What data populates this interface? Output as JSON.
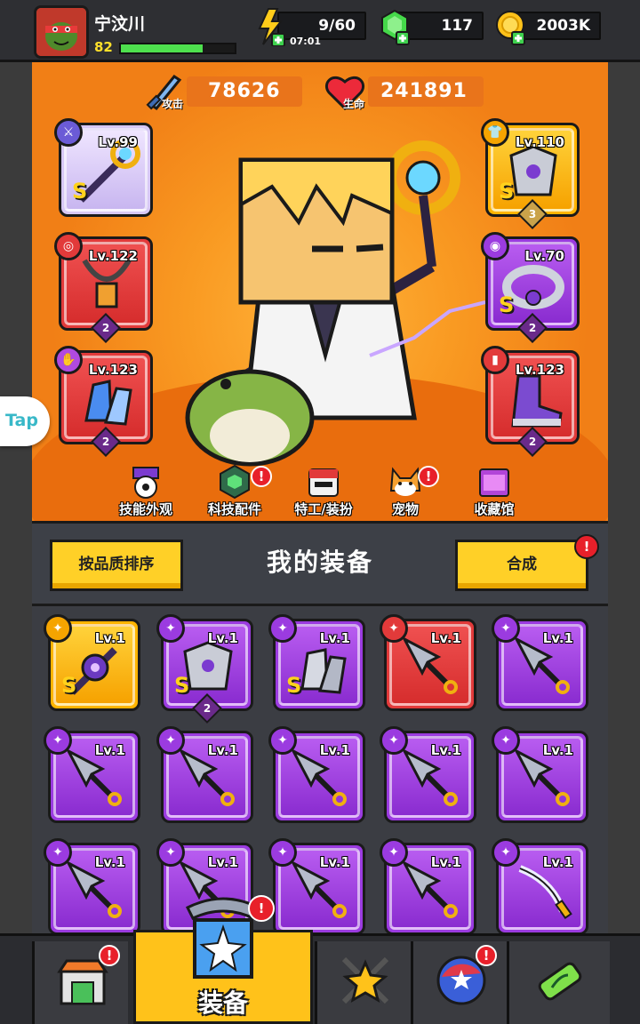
{
  "player": {
    "name": "宁汶川",
    "level": "82",
    "xp_fraction": 0.72
  },
  "resources": {
    "energy": {
      "value": "9/60",
      "timer": "07:01"
    },
    "gems": {
      "value": "117"
    },
    "coins": {
      "value": "2003K"
    }
  },
  "stats": {
    "attack": {
      "label": "攻击",
      "value": "78626"
    },
    "hp": {
      "label": "生命",
      "value": "241891"
    }
  },
  "equipped": {
    "weapon": {
      "level": "Lv.99",
      "grade": "S",
      "badge": ""
    },
    "armor": {
      "level": "Lv.110",
      "grade": "S",
      "badge": "3"
    },
    "necklace": {
      "level": "Lv.122",
      "grade": "",
      "badge": "2"
    },
    "belt": {
      "level": "Lv.70",
      "grade": "S",
      "badge": "2"
    },
    "gloves": {
      "level": "Lv.123",
      "grade": "",
      "badge": "2"
    },
    "boots": {
      "level": "Lv.123",
      "grade": "",
      "badge": "2"
    }
  },
  "nav": [
    {
      "label": "技能外观",
      "alert": false
    },
    {
      "label": "科技配件",
      "alert": true
    },
    {
      "label": "特工/装扮",
      "alert": false
    },
    {
      "label": "宠物",
      "alert": true
    },
    {
      "label": "收藏馆",
      "alert": false
    }
  ],
  "inventory": {
    "title": "我的装备",
    "sort_button": "按品质排序",
    "merge_button": "合成",
    "items": [
      {
        "level": "Lv.1",
        "rarity": "gold",
        "type": "staff",
        "grade": "S",
        "badge": ""
      },
      {
        "level": "Lv.1",
        "rarity": "purple",
        "type": "armor",
        "grade": "S",
        "badge": "2"
      },
      {
        "level": "Lv.1",
        "rarity": "purple",
        "type": "gloves",
        "grade": "S",
        "badge": ""
      },
      {
        "level": "Lv.1",
        "rarity": "red",
        "type": "kunai",
        "grade": "",
        "badge": ""
      },
      {
        "level": "Lv.1",
        "rarity": "purple",
        "type": "kunai",
        "grade": "",
        "badge": ""
      },
      {
        "level": "Lv.1",
        "rarity": "purple",
        "type": "kunai",
        "grade": "",
        "badge": ""
      },
      {
        "level": "Lv.1",
        "rarity": "purple",
        "type": "kunai",
        "grade": "",
        "badge": ""
      },
      {
        "level": "Lv.1",
        "rarity": "purple",
        "type": "kunai",
        "grade": "",
        "badge": ""
      },
      {
        "level": "Lv.1",
        "rarity": "purple",
        "type": "kunai",
        "grade": "",
        "badge": ""
      },
      {
        "level": "Lv.1",
        "rarity": "purple",
        "type": "kunai",
        "grade": "",
        "badge": ""
      },
      {
        "level": "Lv.1",
        "rarity": "purple",
        "type": "kunai",
        "grade": "",
        "badge": ""
      },
      {
        "level": "Lv.1",
        "rarity": "purple",
        "type": "kunai",
        "grade": "",
        "badge": ""
      },
      {
        "level": "Lv.1",
        "rarity": "purple",
        "type": "kunai",
        "grade": "",
        "badge": ""
      },
      {
        "level": "Lv.1",
        "rarity": "purple",
        "type": "kunai",
        "grade": "",
        "badge": ""
      },
      {
        "level": "Lv.1",
        "rarity": "purple",
        "type": "katana",
        "grade": "",
        "badge": ""
      }
    ]
  },
  "bottom_tabs": [
    {
      "label": "",
      "icon": "shop-icon",
      "alert": true
    },
    {
      "label": "装备",
      "icon": "equipment-icon",
      "alert": true,
      "active": true
    },
    {
      "label": "",
      "icon": "battle-icon",
      "alert": false
    },
    {
      "label": "",
      "icon": "talent-orb-icon",
      "alert": true
    },
    {
      "label": "",
      "icon": "dna-capsule-icon",
      "alert": false
    }
  ],
  "side_float": {
    "label": "Tap"
  },
  "colors": {
    "orange": "#f58a1f",
    "gold": "#ffb400",
    "purple": "#9b3be0",
    "red": "#e23a3a",
    "alert": "#e8202a"
  }
}
